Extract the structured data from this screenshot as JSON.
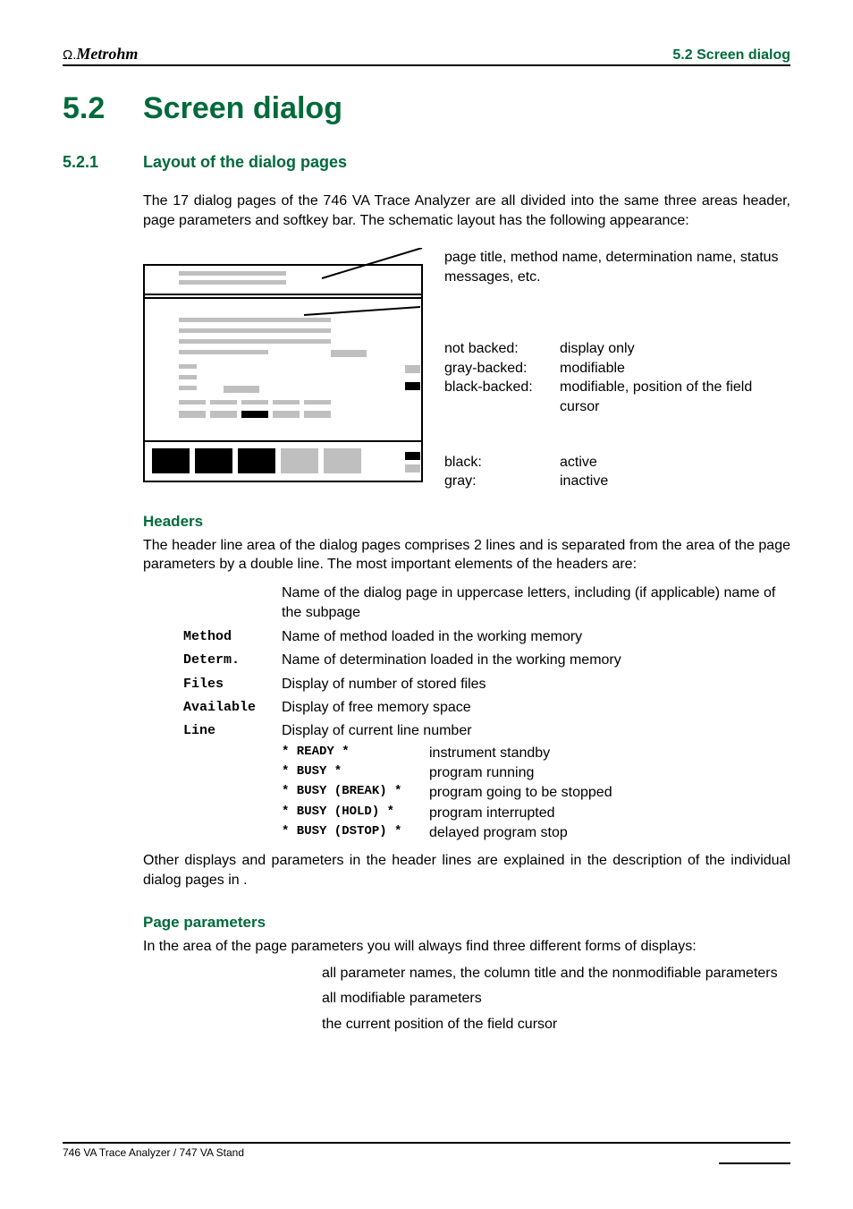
{
  "header": {
    "brand_prefix": "Ω.",
    "brand": "Metrohm",
    "running_section": "5.2  Screen dialog"
  },
  "h1": {
    "num": "5.2",
    "title": "Screen dialog"
  },
  "h2": {
    "num": "5.2.1",
    "title": "Layout of the dialog pages"
  },
  "intro": "The 17 dialog pages of the 746 VA Trace Analyzer are all divided into the same three areas header, page parameters and softkey bar. The schematic layout has the following appearance:",
  "figure": {
    "header_annot": "page title, method name, determination name, status messages, etc.",
    "param_rows": [
      {
        "label": "not backed:",
        "desc": "display only"
      },
      {
        "label": "gray-backed:",
        "desc": "modifiable"
      },
      {
        "label": "black-backed:",
        "desc": "modifiable, position of the field cursor"
      }
    ],
    "softkey_rows": [
      {
        "label": "black:",
        "desc": "active"
      },
      {
        "label": "gray:",
        "desc": "inactive"
      }
    ]
  },
  "headers_section": {
    "title": "Headers",
    "para": "The header line area of the dialog pages comprises 2 lines and is separated from the area of the page parameters by a double line. The most important elements of the headers are:",
    "defs": [
      {
        "term": "",
        "desc": "Name of the dialog page in uppercase letters, including (if applicable) name of the subpage"
      },
      {
        "term": "Method",
        "desc": "Name of method loaded in the working memory"
      },
      {
        "term": "Determ.",
        "desc": "Name of determination loaded in the working memory"
      },
      {
        "term": "Files",
        "desc": "Display of number of stored files"
      },
      {
        "term": "Available",
        "desc": "Display of free memory space"
      },
      {
        "term": "Line",
        "desc": "Display of current line number"
      }
    ],
    "status": [
      {
        "code": "* READY *",
        "desc": "instrument standby"
      },
      {
        "code": "* BUSY *",
        "desc": "program running"
      },
      {
        "code": "* BUSY (BREAK) *",
        "desc": "program going to be stopped"
      },
      {
        "code": "* BUSY (HOLD) *",
        "desc": "program interrupted"
      },
      {
        "code": "* BUSY (DSTOP) *",
        "desc": "delayed program stop"
      }
    ],
    "after": "Other displays and parameters in the header lines are explained in the description of the individual dialog pages in                                         ."
  },
  "params_section": {
    "title": "Page parameters",
    "para": "In the area of the page parameters you will always find three different forms of displays:",
    "list": [
      "all parameter names, the column title and the nonmodifiable parameters",
      "all modifiable parameters",
      "the current position of the field cursor"
    ]
  },
  "footer": {
    "text": "746 VA Trace Analyzer / 747 VA Stand"
  }
}
